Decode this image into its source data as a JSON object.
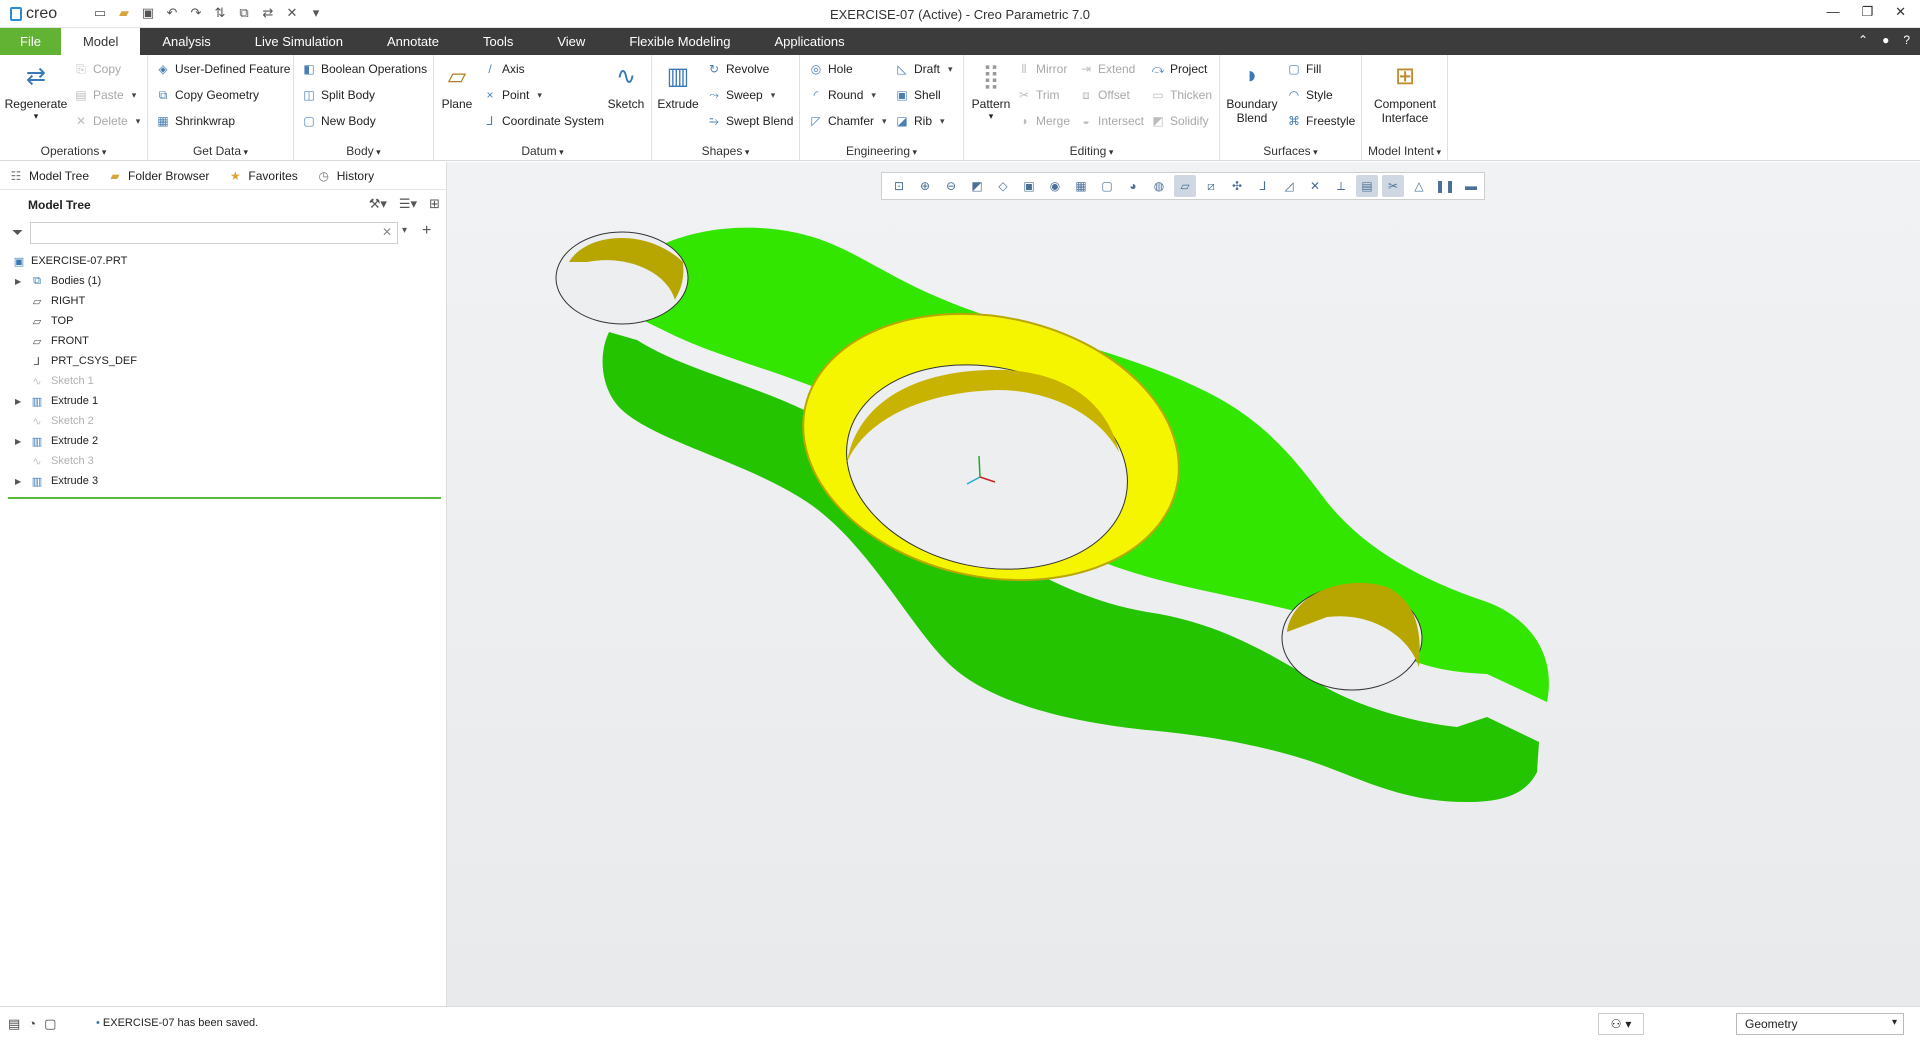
{
  "app": {
    "logo_text": "creo",
    "window_title": "EXERCISE-07 (Active) - Creo Parametric 7.0"
  },
  "menu": {
    "items": [
      "File",
      "Model",
      "Analysis",
      "Live Simulation",
      "Annotate",
      "Tools",
      "View",
      "Flexible Modeling",
      "Applications"
    ],
    "active": "Model"
  },
  "ribbon": {
    "operations": {
      "label": "Operations",
      "regenerate": "Regenerate",
      "copy": "Copy",
      "paste": "Paste",
      "delete": "Delete"
    },
    "getdata": {
      "label": "Get Data",
      "udf": "User-Defined Feature",
      "copygeom": "Copy Geometry",
      "shrinkwrap": "Shrinkwrap"
    },
    "body": {
      "label": "Body",
      "boolean": "Boolean Operations",
      "split": "Split Body",
      "new": "New Body"
    },
    "datum": {
      "label": "Datum",
      "plane": "Plane",
      "axis": "Axis",
      "point": "Point",
      "csys": "Coordinate System",
      "sketch": "Sketch"
    },
    "shapes": {
      "label": "Shapes",
      "extrude": "Extrude",
      "revolve": "Revolve",
      "sweep": "Sweep",
      "sweptblend": "Swept Blend"
    },
    "engineering": {
      "label": "Engineering",
      "hole": "Hole",
      "round": "Round",
      "chamfer": "Chamfer",
      "draft": "Draft",
      "shell": "Shell",
      "rib": "Rib"
    },
    "editing": {
      "label": "Editing",
      "pattern": "Pattern",
      "mirror": "Mirror",
      "trim": "Trim",
      "merge": "Merge",
      "extend": "Extend",
      "offset": "Offset",
      "intersect": "Intersect",
      "project": "Project",
      "thicken": "Thicken",
      "solidify": "Solidify"
    },
    "surfaces": {
      "label": "Surfaces",
      "boundary1": "Boundary",
      "boundary2": "Blend",
      "fill": "Fill",
      "style": "Style",
      "freestyle": "Freestyle"
    },
    "intent": {
      "label": "Model Intent",
      "ci1": "Component",
      "ci2": "Interface"
    }
  },
  "navtabs": [
    "Model Tree",
    "Folder Browser",
    "Favorites",
    "History"
  ],
  "tree": {
    "title": "Model Tree",
    "filter_value": "",
    "items": [
      {
        "label": "EXERCISE-07.PRT",
        "icon": "part-icon",
        "expandable": false,
        "suppressed": false
      },
      {
        "label": "Bodies (1)",
        "icon": "bodies-icon",
        "expandable": true,
        "suppressed": false
      },
      {
        "label": "RIGHT",
        "icon": "datum-plane-icon",
        "expandable": false,
        "suppressed": false
      },
      {
        "label": "TOP",
        "icon": "datum-plane-icon",
        "expandable": false,
        "suppressed": false
      },
      {
        "label": "FRONT",
        "icon": "datum-plane-icon",
        "expandable": false,
        "suppressed": false
      },
      {
        "label": "PRT_CSYS_DEF",
        "icon": "csys-icon",
        "expandable": false,
        "suppressed": false
      },
      {
        "label": "Sketch 1",
        "icon": "sketch-icon",
        "expandable": false,
        "suppressed": true
      },
      {
        "label": "Extrude 1",
        "icon": "extrude-icon",
        "expandable": true,
        "suppressed": false
      },
      {
        "label": "Sketch 2",
        "icon": "sketch-icon",
        "expandable": false,
        "suppressed": true
      },
      {
        "label": "Extrude 2",
        "icon": "extrude-icon",
        "expandable": true,
        "suppressed": false
      },
      {
        "label": "Sketch 3",
        "icon": "sketch-icon",
        "expandable": false,
        "suppressed": true
      },
      {
        "label": "Extrude 3",
        "icon": "extrude-icon",
        "expandable": true,
        "suppressed": false
      }
    ]
  },
  "colors": {
    "accent": "#62b233",
    "menubar": "#3c3c3c",
    "model_green": "#33e600",
    "model_yellow": "#f5f500"
  },
  "status": {
    "message": "EXERCISE-07 has been saved.",
    "filter": "Geometry"
  }
}
